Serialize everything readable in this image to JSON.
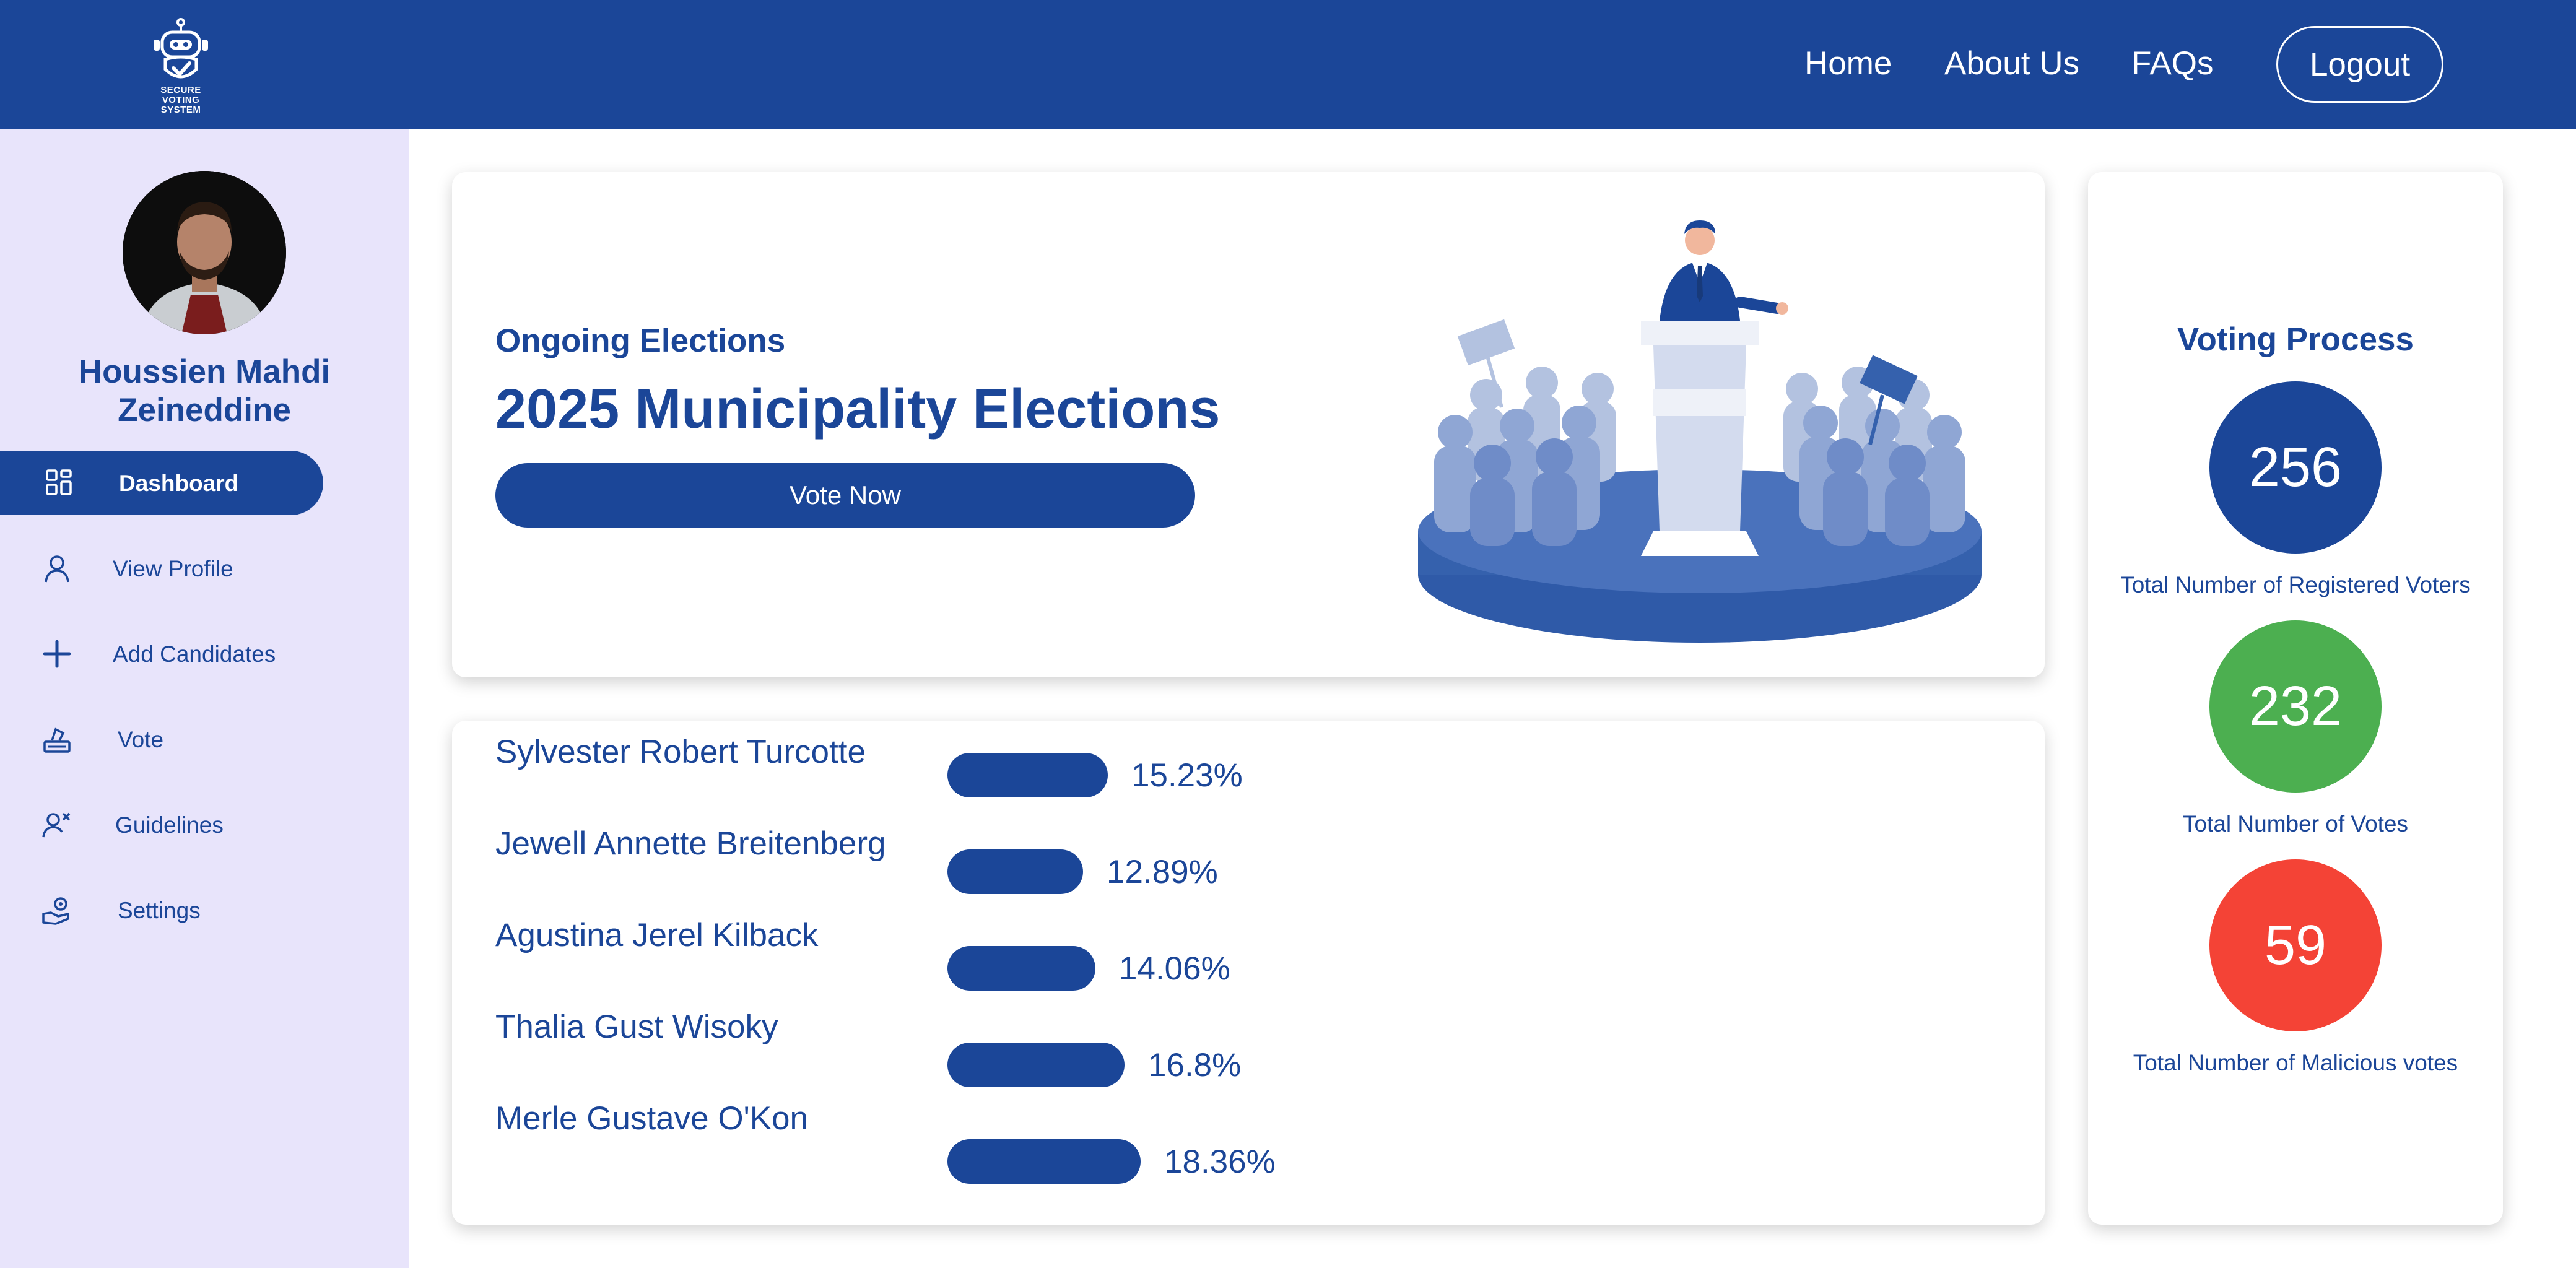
{
  "header": {
    "logo_text": "SECURE VOTING SYSTEM",
    "nav": [
      "Home",
      "About Us",
      "FAQs"
    ],
    "logout_label": "Logout"
  },
  "sidebar": {
    "user_name": "Houssien Mahdi Zeineddine",
    "items": [
      {
        "label": "Dashboard",
        "icon": "dashboard-grid-icon",
        "active": true
      },
      {
        "label": "View Profile",
        "icon": "user-icon",
        "active": false
      },
      {
        "label": "Add Candidates",
        "icon": "plus-icon",
        "active": false
      },
      {
        "label": "Vote",
        "icon": "ballot-box-icon",
        "active": false
      },
      {
        "label": "Guidelines",
        "icon": "user-x-icon",
        "active": false
      },
      {
        "label": "Settings",
        "icon": "hand-gear-icon",
        "active": false
      }
    ]
  },
  "hero": {
    "subtitle": "Ongoing Elections",
    "title": "2025 Municipality Elections",
    "button_label": "Vote Now"
  },
  "results": [
    {
      "name": "Sylvester Robert Turcotte",
      "percent": 15.23,
      "label": "15.23%"
    },
    {
      "name": "Jewell Annette Breitenberg",
      "percent": 12.89,
      "label": "12.89%"
    },
    {
      "name": "Agustina Jerel Kilback",
      "percent": 14.06,
      "label": "14.06%"
    },
    {
      "name": "Thalia Gust Wisoky",
      "percent": 16.8,
      "label": "16.8%"
    },
    {
      "name": "Merle Gustave O'Kon",
      "percent": 18.36,
      "label": "18.36%"
    }
  ],
  "stats": {
    "title": "Voting Process",
    "items": [
      {
        "value": "256",
        "label": "Total Number of Registered Voters",
        "color": "#1b4698"
      },
      {
        "value": "232",
        "label": "Total Number of Votes",
        "color": "#4caf50"
      },
      {
        "value": "59",
        "label": "Total Number of Malicious votes",
        "color": "#f44336"
      }
    ]
  },
  "colors": {
    "primary": "#1b4698",
    "sidebar_bg": "#e8e4fb",
    "success": "#4caf50",
    "danger": "#f44336"
  }
}
